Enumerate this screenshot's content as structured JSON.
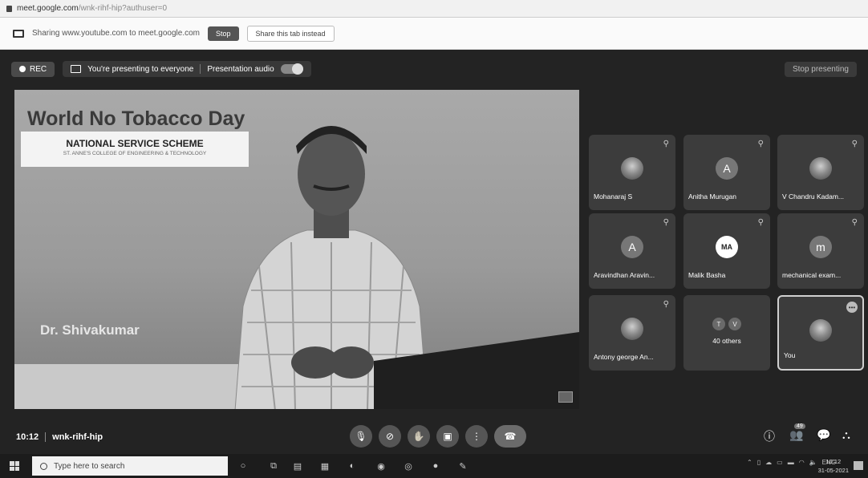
{
  "browser": {
    "url_host": "meet.google.com",
    "url_path": "/wnk-rihf-hip?authuser=0"
  },
  "sharebar": {
    "text": "Sharing www.youtube.com to meet.google.com",
    "stop_label": "Stop",
    "share_tab_label": "Share this tab instead"
  },
  "topbar": {
    "rec_label": "REC",
    "presenting_label": "You're presenting to everyone",
    "audio_label": "Presentation audio",
    "audio_toggle": "on",
    "stop_presenting_label": "Stop presenting"
  },
  "main_video": {
    "title": "World No Tobacco Day",
    "org_line1": "NATIONAL SERVICE SCHEME",
    "org_line2": "ST. ANNE'S COLLEGE OF ENGINEERING & TECHNOLOGY",
    "speaker": "Dr. Shivakumar"
  },
  "participants": [
    {
      "name": "Mohanaraj S",
      "avatar": "",
      "photo": true,
      "muted": true
    },
    {
      "name": "Anitha Murugan",
      "avatar": "A",
      "photo": false,
      "muted": true
    },
    {
      "name": "V Chandru Kadam...",
      "avatar": "",
      "photo": true,
      "muted": true
    },
    {
      "name": "Aravindhan Aravin...",
      "avatar": "A",
      "photo": false,
      "muted": true
    },
    {
      "name": "Malik Basha",
      "avatar": "MA",
      "photo": false,
      "muted": true
    },
    {
      "name": "mechanical exam...",
      "avatar": "m",
      "photo": false,
      "muted": true
    },
    {
      "name": "Antony george An...",
      "avatar": "",
      "photo": true,
      "muted": true
    },
    {
      "name": "40 others",
      "avatar": "",
      "mini": [
        "T",
        "V"
      ],
      "photo": false,
      "muted": false
    },
    {
      "name": "You",
      "avatar": "",
      "photo": true,
      "muted": false
    }
  ],
  "controls": {
    "time": "10:12",
    "meeting_code": "wnk-rihf-hip",
    "people_count": "49",
    "icons": [
      "mic-icon",
      "camera-off-icon",
      "raise-hand-icon",
      "present-icon",
      "more-options-icon",
      "leave-call-icon"
    ]
  },
  "taskbar": {
    "search_placeholder": "Type here to search",
    "lang": "ENG",
    "clock_time": "10:12",
    "clock_date": "31-05-2021"
  }
}
